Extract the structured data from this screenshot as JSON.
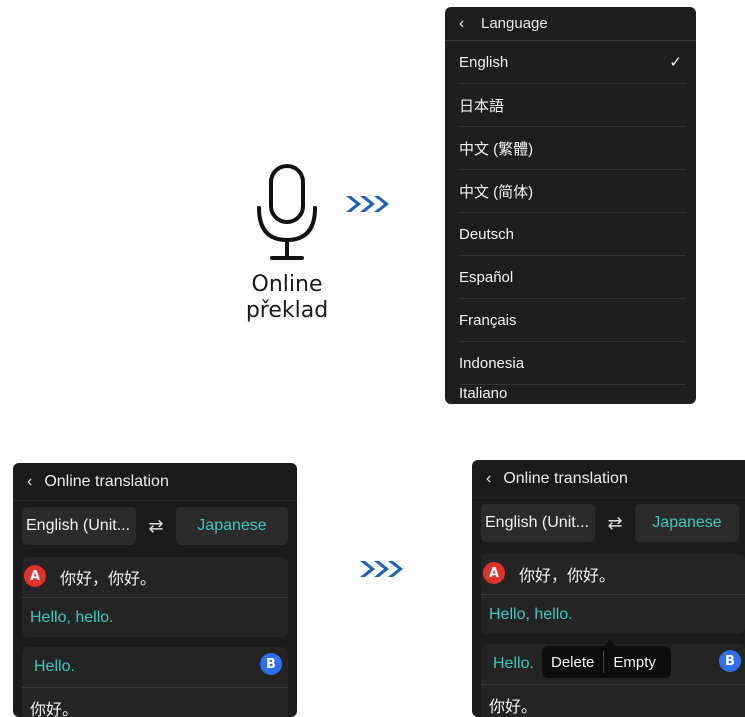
{
  "mic_label_line1": "Online",
  "mic_label_line2": "překlad",
  "arrow_glyph": "›››",
  "language_panel": {
    "title": "Language",
    "items": [
      {
        "label": "English",
        "selected": true
      },
      {
        "label": "日本語",
        "selected": false
      },
      {
        "label": "中文 (繁體)",
        "selected": false
      },
      {
        "label": "中文 (简体)",
        "selected": false
      },
      {
        "label": "Deutsch",
        "selected": false
      },
      {
        "label": "Español",
        "selected": false
      },
      {
        "label": "Français",
        "selected": false
      },
      {
        "label": "Indonesia",
        "selected": false
      },
      {
        "label": "Italiano",
        "selected": false
      }
    ],
    "check_mark": "✓"
  },
  "translation_screen": {
    "title": "Online translation",
    "source_language": "English (Unit...",
    "target_language": "Japanese",
    "swap_icon": "⇄",
    "conversation_a": {
      "badge": "A",
      "original": "你好，你好。",
      "translation": "Hello, hello."
    },
    "conversation_b": {
      "badge": "B",
      "original": "Hello.",
      "translation": "你好。"
    }
  },
  "context_menu": {
    "delete_label": "Delete",
    "empty_label": "Empty"
  },
  "colors": {
    "accent_teal": "#3ec6c0",
    "badge_a": "#e0322d",
    "badge_b": "#2f6fe8",
    "arrows": "#1f63b8"
  }
}
